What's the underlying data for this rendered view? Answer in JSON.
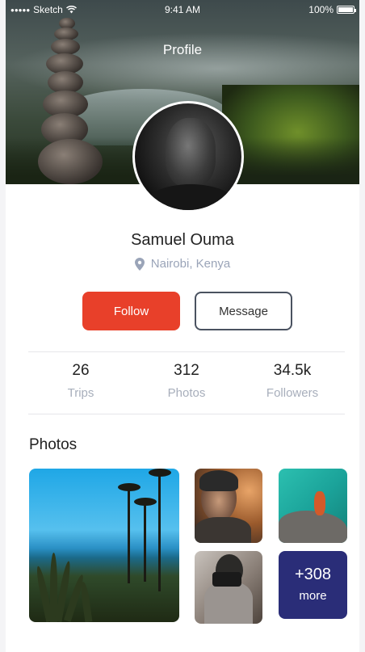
{
  "status_bar": {
    "signal": "●●●●●",
    "carrier": "Sketch",
    "time": "9:41 AM",
    "battery": "100%"
  },
  "header": {
    "title": "Profile"
  },
  "profile": {
    "name": "Samuel Ouma",
    "location": "Nairobi, Kenya"
  },
  "actions": {
    "follow_label": "Follow",
    "message_label": "Message"
  },
  "stats": [
    {
      "value": "26",
      "label": "Trips"
    },
    {
      "value": "312",
      "label": "Photos"
    },
    {
      "value": "34.5k",
      "label": "Followers"
    }
  ],
  "photos": {
    "title": "Photos",
    "more_count": "+308",
    "more_label": "more"
  },
  "colors": {
    "accent": "#e8402a",
    "more_tile": "#2a2d78",
    "muted_text": "#a7aebb"
  }
}
